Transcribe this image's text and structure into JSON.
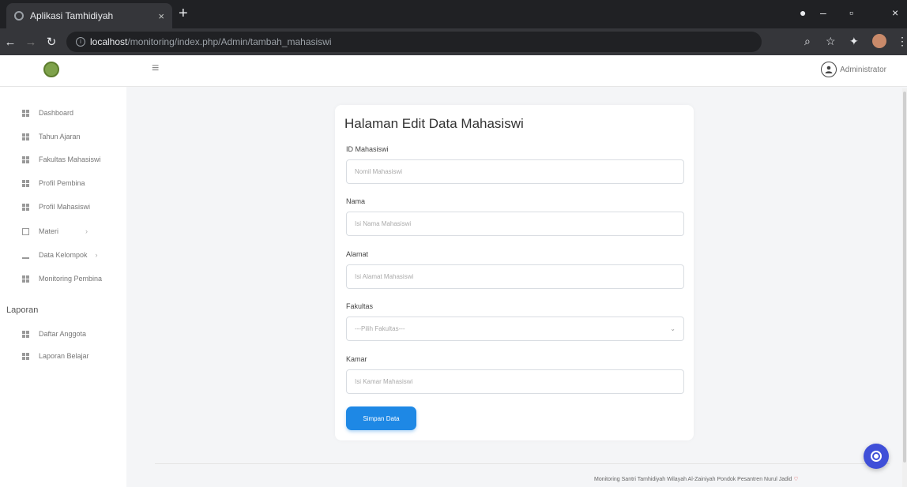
{
  "browser": {
    "tab_title": "Aplikasi Tamhidiyah",
    "tab_close": "×",
    "new_tab": "+",
    "url_host": "localhost",
    "url_path": "/monitoring/index.php/Admin/tambah_mahasiswi",
    "win_minimize": "–",
    "win_maximize": "▫",
    "win_close": "×"
  },
  "header": {
    "hamburger": "≡",
    "user_name": "Administrator"
  },
  "sidebar": {
    "items": [
      {
        "label": "Dashboard"
      },
      {
        "label": "Tahun Ajaran"
      },
      {
        "label": "Fakultas Mahasiswi"
      },
      {
        "label": "Profil Pembina"
      },
      {
        "label": "Profil Mahasiswi"
      },
      {
        "label": "Materi"
      },
      {
        "label": "Data Kelompok"
      },
      {
        "label": "Monitoring Pembina"
      }
    ],
    "section_title": "Laporan",
    "report_items": [
      {
        "label": "Daftar Anggota"
      },
      {
        "label": "Laporan Belajar"
      }
    ],
    "arrow": "›"
  },
  "form": {
    "title": "Halaman Edit Data Mahasiswi",
    "fields": [
      {
        "label": "ID Mahasiswi",
        "placeholder": "Nomil Mahasiswi"
      },
      {
        "label": "Nama",
        "placeholder": "Isi Nama Mahasiswi"
      },
      {
        "label": "Alamat",
        "placeholder": "Isi Alamat Mahasiswi"
      },
      {
        "label": "Fakultas",
        "placeholder": "---Pilih Fakultas---"
      },
      {
        "label": "Kamar",
        "placeholder": "Isi Kamar Mahasiswi"
      }
    ],
    "select_chevron": "⌄",
    "submit_label": "Simpan Data"
  },
  "footer": {
    "text": "Monitoring Santri Tamhidiyah Wilayah Al-Zainiyah Pondok Pesantren Nurul Jadid",
    "heart": "♡"
  },
  "colors": {
    "primary": "#1e88e5",
    "fab": "#3f4fd8"
  }
}
